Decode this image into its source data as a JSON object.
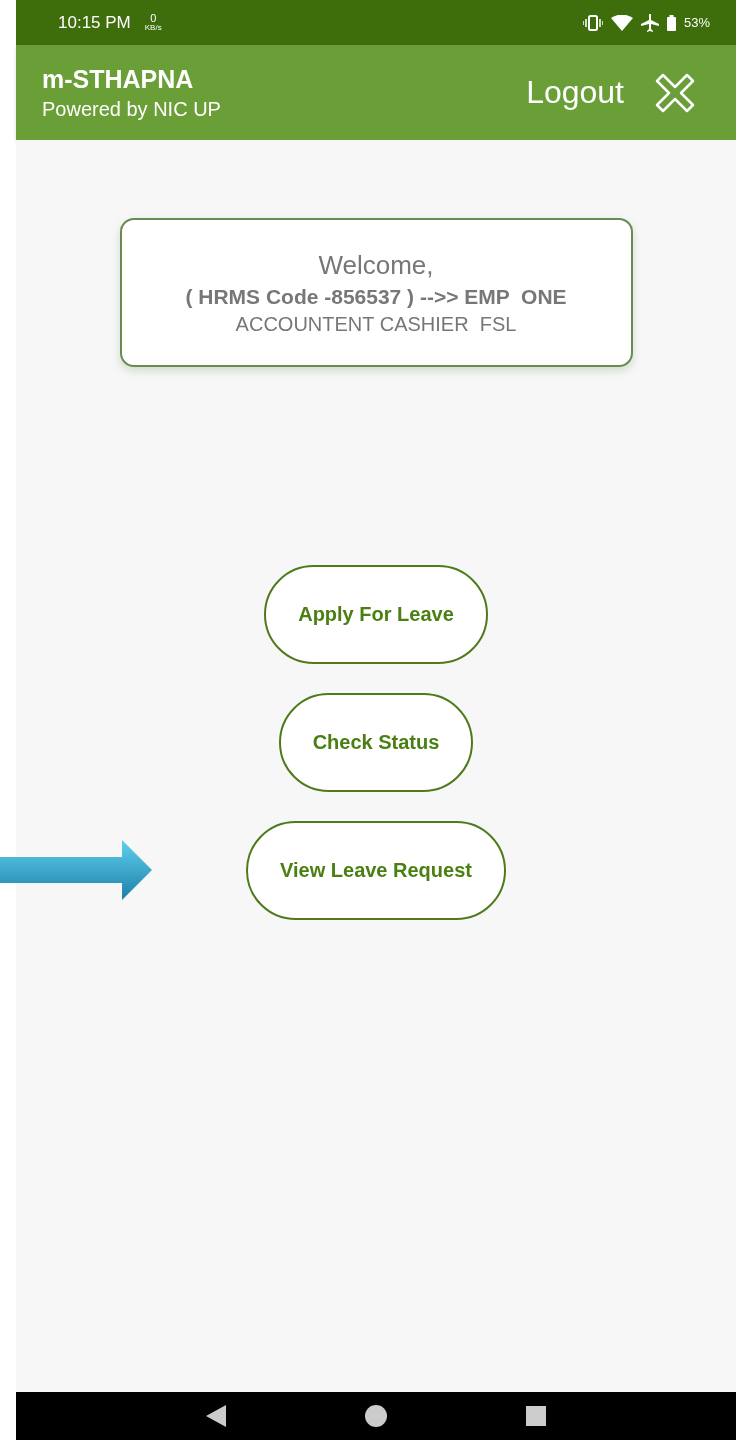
{
  "status_bar": {
    "time": "10:15 PM",
    "speed_value": "0",
    "speed_unit": "KB/s",
    "battery": "53%"
  },
  "app_bar": {
    "title": "m-STHAPNA",
    "subtitle": "Powered by NIC UP",
    "logout": "Logout"
  },
  "welcome_card": {
    "greeting": "Welcome,",
    "employee": "( HRMS Code -856537 ) -->> EMP  ONE",
    "designation": "ACCOUNTENT CASHIER  FSL"
  },
  "buttons": [
    {
      "label": "Apply For Leave"
    },
    {
      "label": "Check Status"
    },
    {
      "label": "View Leave Request",
      "pointed": true
    }
  ]
}
